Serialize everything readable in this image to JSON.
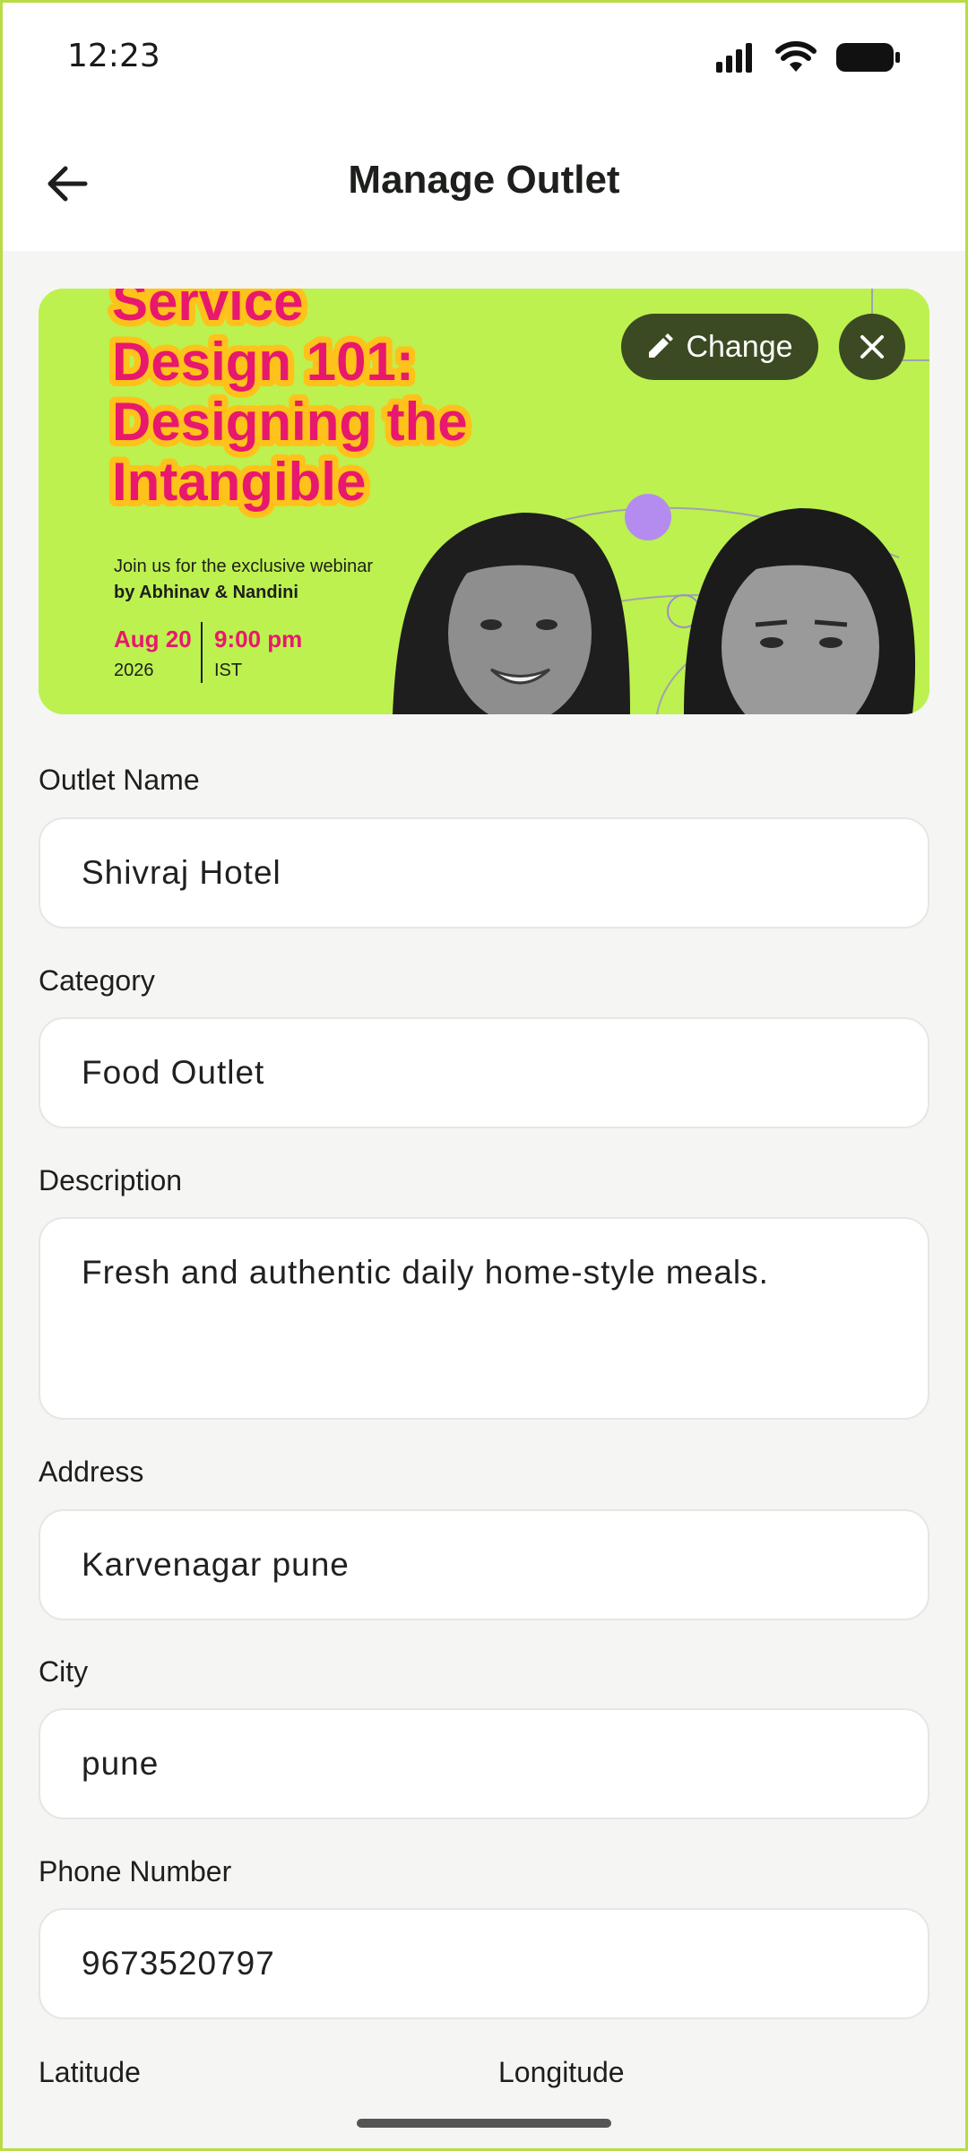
{
  "status_bar": {
    "time": "12:23"
  },
  "header": {
    "title": "Manage Outlet"
  },
  "banner": {
    "title_lines": [
      "Service",
      "Design 101:",
      "Designing the",
      "Intangible"
    ],
    "invite_line": "Join us for the exclusive webinar",
    "hosts_line": "by Abhinav & Nandini",
    "date": "Aug 20",
    "year": "2026",
    "time": "9:00 pm",
    "timezone": "IST",
    "change_label": "Change"
  },
  "form": {
    "outlet_name": {
      "label": "Outlet Name",
      "value": "Shivraj Hotel"
    },
    "category": {
      "label": "Category",
      "value": "Food Outlet"
    },
    "description": {
      "label": "Description",
      "value": "Fresh and authentic daily home-style meals."
    },
    "address": {
      "label": "Address",
      "value": "Karvenagar pune"
    },
    "city": {
      "label": "City",
      "value": "pune"
    },
    "phone": {
      "label": "Phone Number",
      "value": "9673520797"
    },
    "latitude": {
      "label": "Latitude"
    },
    "longitude": {
      "label": "Longitude"
    }
  },
  "colors": {
    "accent_dark": "#3b4a22",
    "banner_green": "#bdf14f",
    "banner_pink": "#e8186e",
    "frame_border": "#b8dc45"
  }
}
